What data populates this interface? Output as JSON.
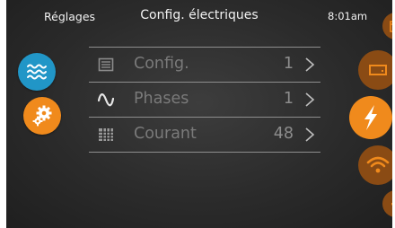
{
  "header": {
    "back_label": "Réglages",
    "title": "Config. électriques",
    "time": "8:01am"
  },
  "left_nav": [
    {
      "icon": "water-waves-icon",
      "color": "#2196c7"
    },
    {
      "icon": "gears-icon",
      "color": "#f08a1c",
      "selected": true
    }
  ],
  "right_nav": [
    {
      "icon": "calendar-icon",
      "color": "#8a4b14"
    },
    {
      "icon": "display-icon",
      "color": "#8a4b14"
    },
    {
      "icon": "lightning-icon",
      "color": "#f08a1c",
      "selected": true
    },
    {
      "icon": "wifi-icon",
      "color": "#8a4b14"
    },
    {
      "icon": "more-icon",
      "color": "#8a4b14"
    }
  ],
  "menu": {
    "items": [
      {
        "icon": "config-list-icon",
        "label": "Config.",
        "value": "1"
      },
      {
        "icon": "sine-wave-icon",
        "label": "Phases",
        "value": "1"
      },
      {
        "icon": "current-grid-icon",
        "label": "Courant",
        "value": "48"
      }
    ]
  },
  "colors": {
    "background": "#2b2b2b",
    "accent_orange": "#f08a1c",
    "accent_blue": "#2196c7",
    "inactive_brown": "#8a4b14",
    "row_text": "#7a7a7a"
  }
}
